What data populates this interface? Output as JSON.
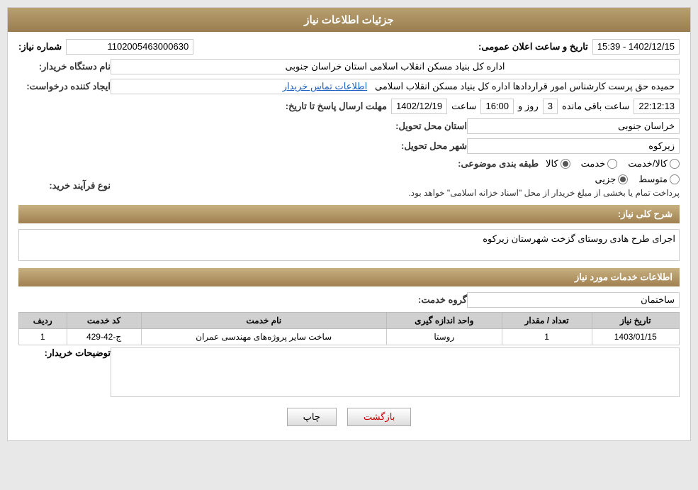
{
  "header": {
    "title": "جزئیات اطلاعات نیاز"
  },
  "fields": {
    "shomareNiaz_label": "شماره نیاز:",
    "shomareNiaz_value": "1102005463000630",
    "namDastgah_label": "نام دستگاه خریدار:",
    "namDastgah_value": "اداره کل بنیاد مسکن انقلاب اسلامی استان خراسان جنوبی",
    "ijadKonande_label": "ایجاد کننده درخواست:",
    "ijadKonande_value": "حمیده حق پرست کارشناس امور قراردادها اداره کل بنیاد مسکن انقلاب اسلامی",
    "ittilaat_link": "اطلاعات تماس خریدار",
    "tarikh_label": "تاریخ و ساعت اعلان عمومی:",
    "tarikh_value": "1402/12/15 - 15:39",
    "mohlat_label": "مهلت ارسال پاسخ تا تاریخ:",
    "mohlat_date": "1402/12/19",
    "mohlat_saaat_label": "ساعت",
    "mohlat_saat": "16:00",
    "mohlat_roz_label": "روز و",
    "mohlat_roz": "3",
    "mohlat_baqi": "22:12:13",
    "mohlat_baqi_label": "ساعت باقی مانده",
    "ostan_label": "استان محل تحویل:",
    "ostan_value": "خراسان جنوبی",
    "shahr_label": "شهر محل تحویل:",
    "shahr_value": "زیرکوه",
    "tabaqe_label": "طبقه بندی موضوعی:",
    "tabaqe_kala": "کالا",
    "tabaqe_khedmat": "خدمت",
    "tabaqe_kala_khedmat": "کالا/خدمت",
    "nav_label": "نوع فرآیند خرید:",
    "nav_jozi": "جزیی",
    "nav_mottasat": "متوسط",
    "nav_note": "پرداخت تمام یا بخشی از مبلغ خریدار از محل \"اسناد خزانه اسلامی\" خواهد بود.",
    "sharh_label": "شرح کلی نیاز:",
    "sharh_value": "اجرای طرح هادی روستای گزخت شهرستان زیرکوه",
    "section_services": "اطلاعات خدمات مورد نیاز",
    "grohe_hedmat_label": "گروه خدمت:",
    "grohe_khedmat_value": "ساختمان",
    "table_headers": {
      "radif": "ردیف",
      "code": "کد خدمت",
      "name": "نام خدمت",
      "unit": "واحد اندازه گیری",
      "count": "تعداد / مقدار",
      "date": "تاریخ نیاز"
    },
    "table_rows": [
      {
        "radif": "1",
        "code": "ج-42-429",
        "name": "ساخت سایر پروژه‌های مهندسی عمران",
        "unit": "روستا",
        "count": "1",
        "date": "1403/01/15"
      }
    ],
    "tozihat_label": "توضیحات خریدار:",
    "tozihat_value": "",
    "btn_print": "چاپ",
    "btn_back": "بازگشت"
  }
}
